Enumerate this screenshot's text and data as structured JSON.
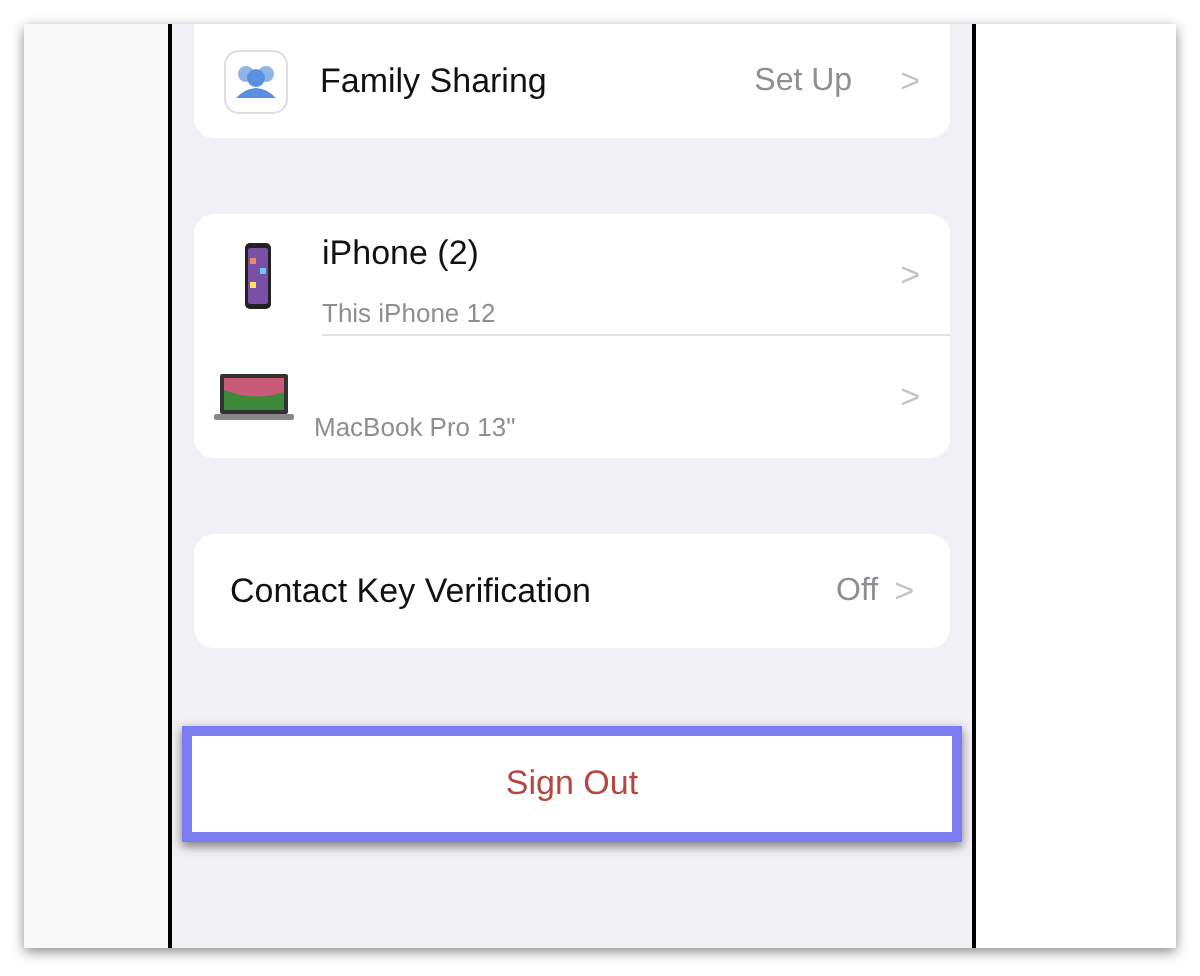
{
  "family_sharing": {
    "label": "Family Sharing",
    "value": "Set Up",
    "chevron": ">"
  },
  "devices": [
    {
      "kind": "phone",
      "name": "iPhone (2)",
      "detail": "This iPhone 12",
      "chevron": ">"
    },
    {
      "kind": "laptop",
      "detail": "MacBook Pro 13\"",
      "chevron": ">"
    }
  ],
  "contact_key": {
    "label": "Contact Key Verification",
    "value": "Off",
    "chevron": ">"
  },
  "sign_out": {
    "label": "Sign Out",
    "highlighted": true
  }
}
